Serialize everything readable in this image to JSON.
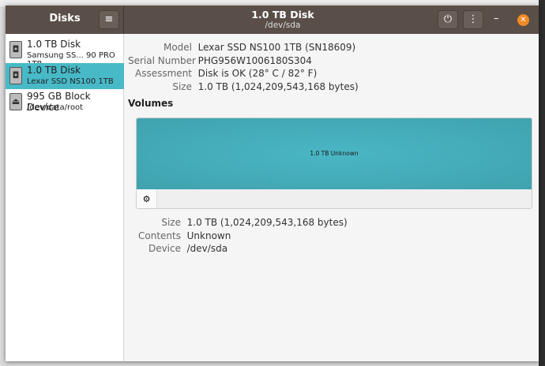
{
  "sidebar": {
    "title": "Disks",
    "items": [
      {
        "name": "1.0 TB Disk",
        "sub": "Samsung SS... 90 PRO 1TB"
      },
      {
        "name": "1.0 TB Disk",
        "sub": "Lexar SSD NS100 1TB"
      },
      {
        "name": "995 GB Block Device",
        "sub": "/dev/data/root"
      }
    ]
  },
  "header": {
    "title": "1.0 TB Disk",
    "subtitle": "/dev/sda"
  },
  "details": [
    {
      "k": "Model",
      "v": "Lexar SSD NS100 1TB (SN18609)"
    },
    {
      "k": "Serial Number",
      "v": "PHG956W1006180S304"
    },
    {
      "k": "Assessment",
      "v": "Disk is OK (28° C / 82° F)"
    },
    {
      "k": "Size",
      "v": "1.0 TB (1,024,209,543,168 bytes)"
    }
  ],
  "volumes_heading": "Volumes",
  "volume_bar_label": "1.0 TB Unknown",
  "volume_details": [
    {
      "k": "Size",
      "v": "1.0 TB (1,024,209,543,168 bytes)"
    },
    {
      "k": "Contents",
      "v": "Unknown"
    },
    {
      "k": "Device",
      "v": "/dev/sda"
    }
  ],
  "colors": {
    "accent": "#48b9c7",
    "header": "#5a4f48",
    "close": "#f08a24"
  }
}
